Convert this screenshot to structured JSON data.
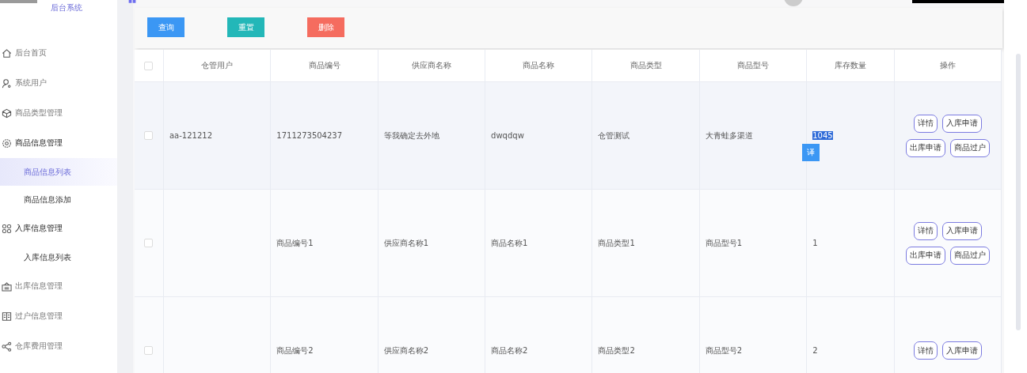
{
  "sidebar": {
    "brand": "后台系统",
    "items": [
      {
        "label": "后台首页",
        "expanded": false
      },
      {
        "label": "系统用户",
        "expanded": false
      },
      {
        "label": "商品类型管理",
        "expanded": false
      },
      {
        "label": "商品信息管理",
        "expanded": true,
        "children": [
          {
            "label": "商品信息列表",
            "selected": true
          },
          {
            "label": "商品信息添加",
            "selected": false
          }
        ]
      },
      {
        "label": "入库信息管理",
        "expanded": true,
        "children": [
          {
            "label": "入库信息列表",
            "selected": false
          }
        ]
      },
      {
        "label": "出库信息管理",
        "expanded": false
      },
      {
        "label": "过户信息管理",
        "expanded": false
      },
      {
        "label": "仓库费用管理",
        "expanded": false
      }
    ]
  },
  "toolbar": {
    "buttons": [
      {
        "label": "查询",
        "kind": "search"
      },
      {
        "label": "重置",
        "kind": "reset"
      },
      {
        "label": "删除",
        "kind": "delete"
      }
    ]
  },
  "table": {
    "header_checked": false,
    "columns": [
      "仓管用户",
      "商品编号",
      "供应商名称",
      "商品名称",
      "商品类型",
      "商品型号",
      "库存数量",
      "操作"
    ],
    "rows": [
      {
        "checked": false,
        "cells": [
          "aa-121212",
          "1711273504237",
          "等我确定去外地",
          "dwqdqw",
          "仓管测试",
          "大青蛙多渠道",
          "1045"
        ],
        "highlighted": true,
        "actions": [
          "详情",
          "入库申请",
          "出库申请",
          "商品过户"
        ]
      },
      {
        "checked": false,
        "cells": [
          "",
          "商品编号1",
          "供应商名称1",
          "商品名称1",
          "商品类型1",
          "商品型号1",
          "1"
        ],
        "highlighted": false,
        "actions": [
          "详情",
          "入库申请",
          "出库申请",
          "商品过户"
        ]
      },
      {
        "checked": false,
        "cells": [
          "",
          "商品编号2",
          "供应商名称2",
          "商品名称2",
          "商品类型2",
          "商品型号2",
          "2"
        ],
        "highlighted": false,
        "actions": [
          "详情",
          "入库申请"
        ]
      }
    ]
  },
  "translate_popup": {
    "label": "译"
  }
}
